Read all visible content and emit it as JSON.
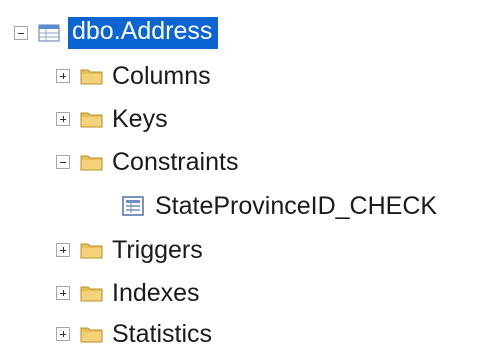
{
  "tree": {
    "root": {
      "label": "dbo.Address",
      "icon": "table-icon",
      "expanded": true,
      "selected": true
    },
    "items": [
      {
        "label": "Columns",
        "icon": "folder-icon",
        "expanded": false
      },
      {
        "label": "Keys",
        "icon": "folder-icon",
        "expanded": false
      },
      {
        "label": "Constraints",
        "icon": "folder-icon",
        "expanded": true
      },
      {
        "label": "StateProvinceID_CHECK",
        "icon": "constraint-icon"
      },
      {
        "label": "Triggers",
        "icon": "folder-icon",
        "expanded": false
      },
      {
        "label": "Indexes",
        "icon": "folder-icon",
        "expanded": false
      },
      {
        "label": "Statistics",
        "icon": "folder-icon",
        "expanded": false
      }
    ]
  },
  "colors": {
    "selection": "#0a64d2",
    "folder": "#e8c05a"
  }
}
